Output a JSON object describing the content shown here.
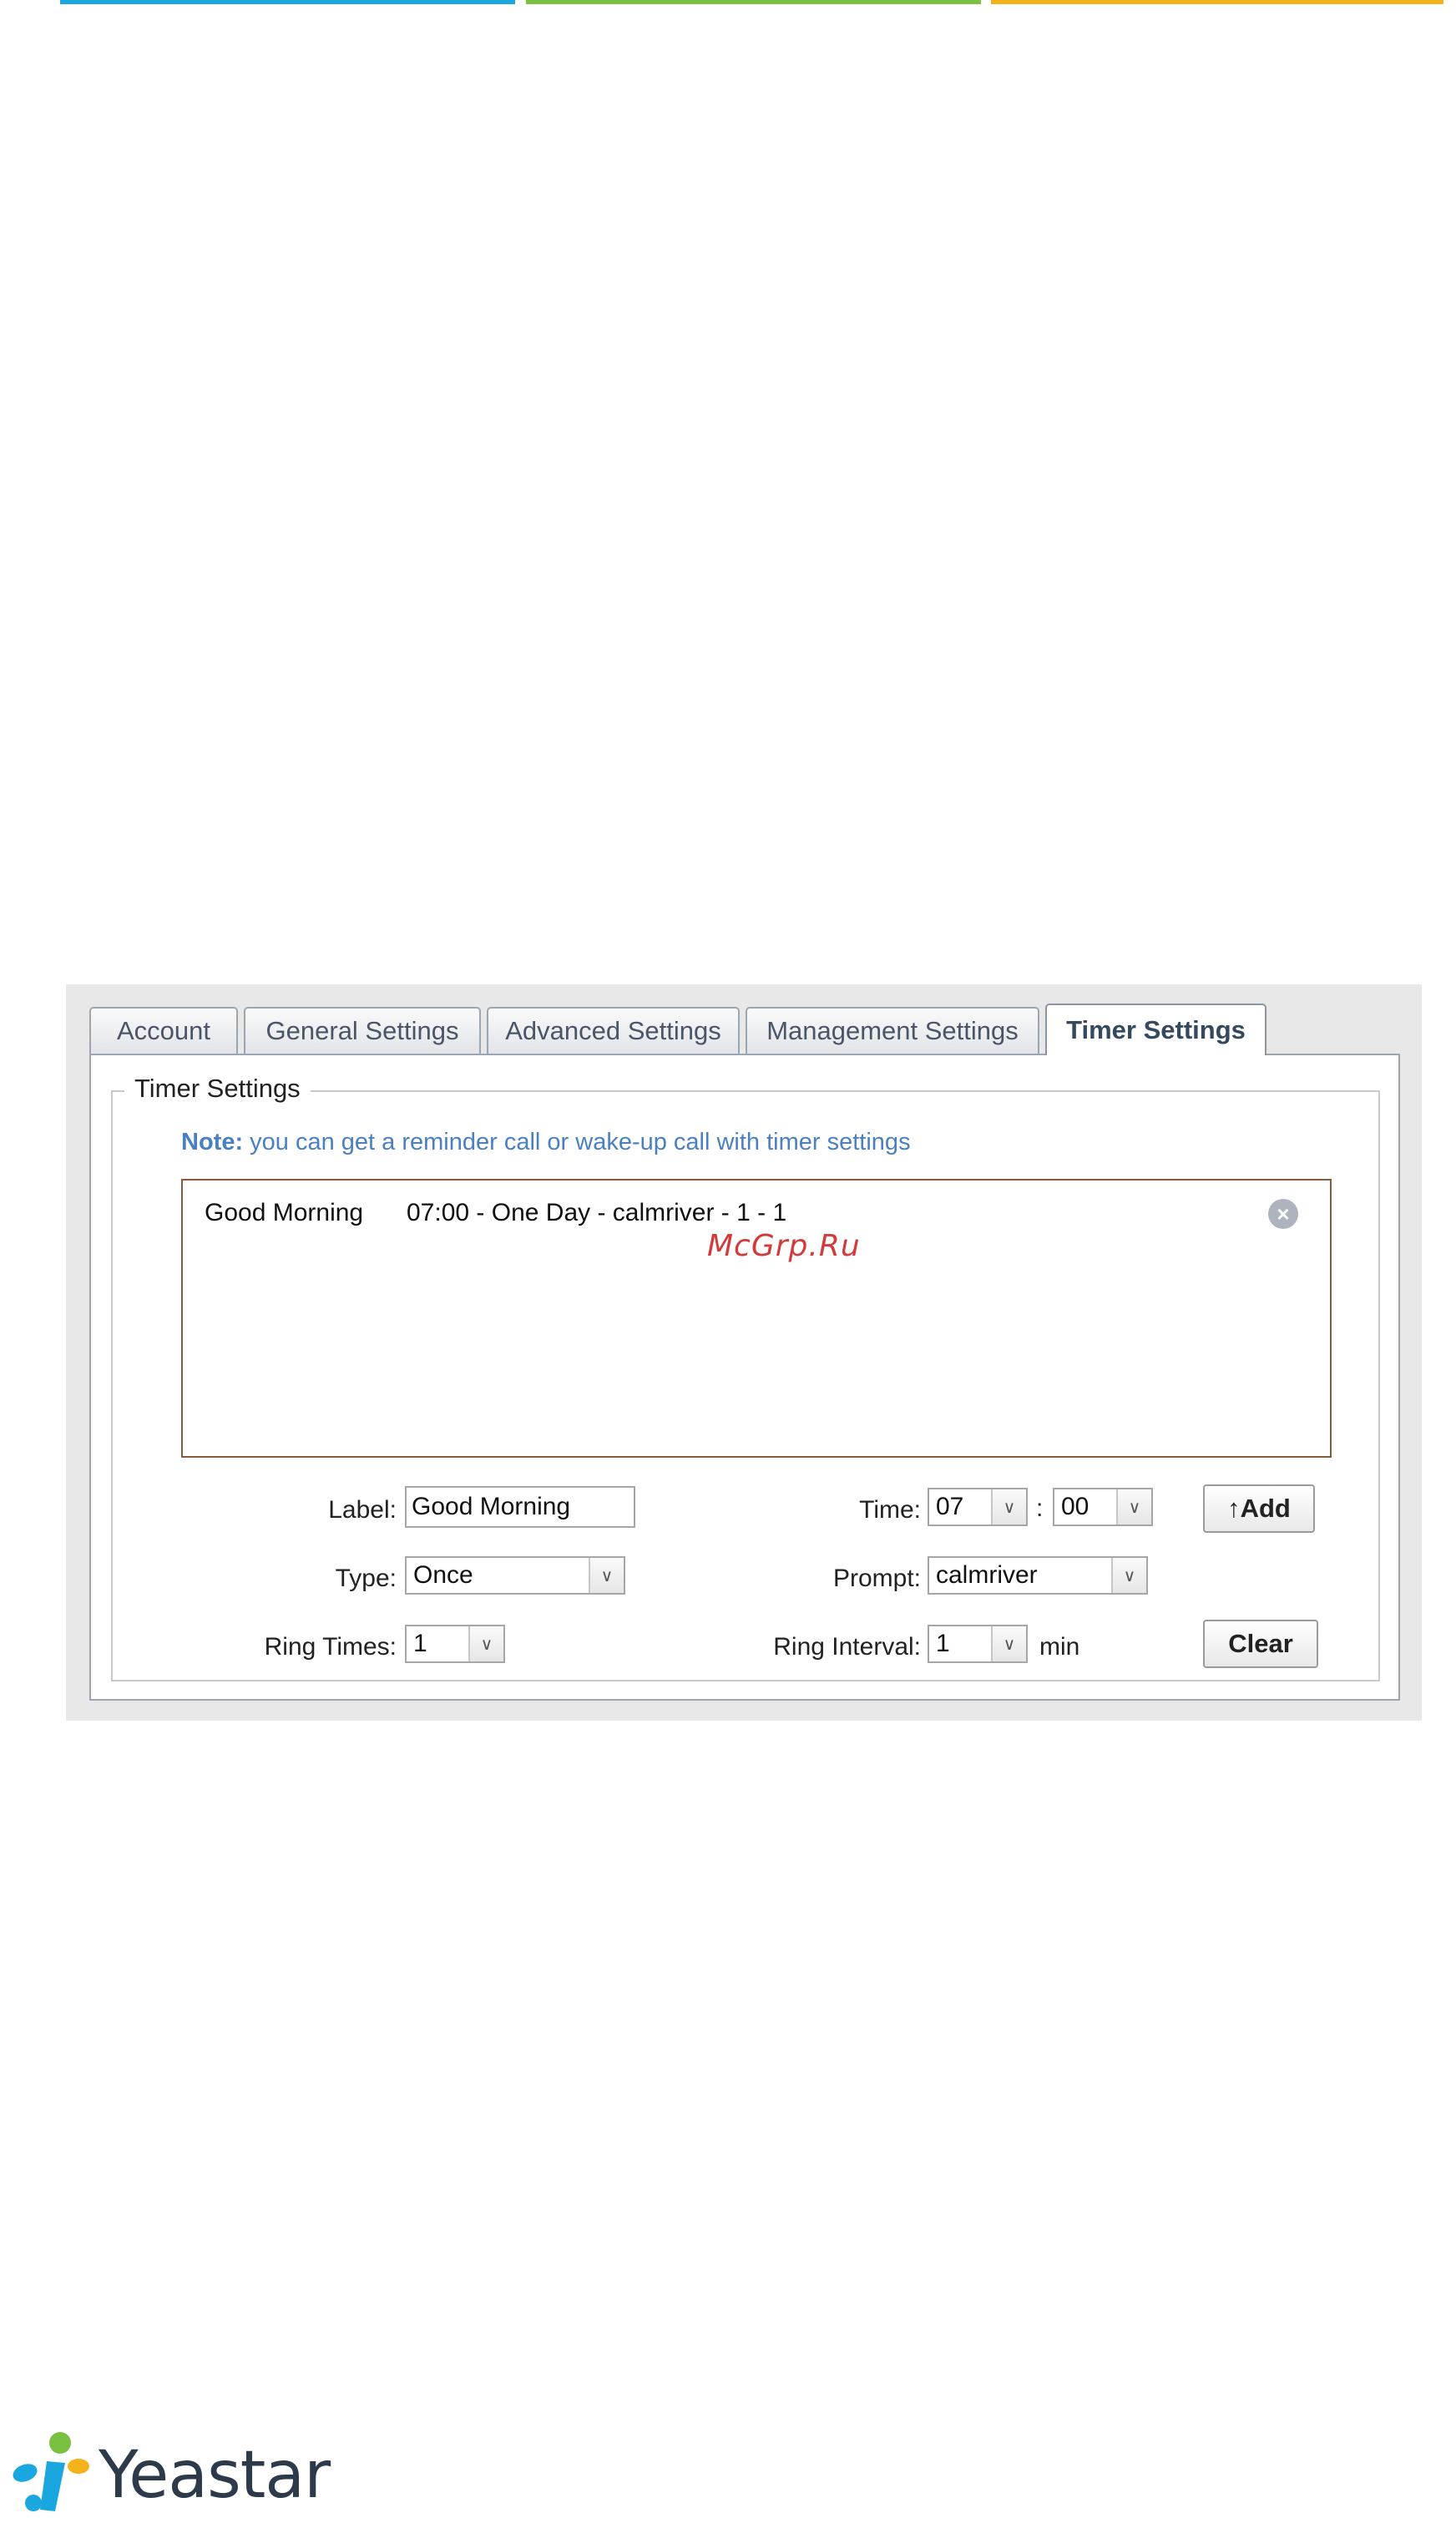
{
  "tabs": [
    {
      "label": "Account",
      "active": false
    },
    {
      "label": "General Settings",
      "active": false
    },
    {
      "label": "Advanced Settings",
      "active": false
    },
    {
      "label": "Management Settings",
      "active": false
    },
    {
      "label": "Timer Settings",
      "active": true
    }
  ],
  "section": {
    "legend": "Timer Settings",
    "note_prefix": "Note:",
    "note_text": " you can get a reminder call or wake-up call with timer settings"
  },
  "timer_list": [
    {
      "label": "Good Morning",
      "details": "07:00 - One Day - calmriver - 1 - 1"
    }
  ],
  "watermark": "McGrp.Ru",
  "form": {
    "label_field": {
      "label": "Label:",
      "value": "Good Morning"
    },
    "time_field": {
      "label": "Time:",
      "hour": "07",
      "separator": ":",
      "minute": "00"
    },
    "add_button": "↑Add",
    "type_field": {
      "label": "Type:",
      "value": "Once"
    },
    "prompt_field": {
      "label": "Prompt:",
      "value": "calmriver"
    },
    "ring_times_field": {
      "label": "Ring Times:",
      "value": "1"
    },
    "ring_interval_field": {
      "label": "Ring Interval:",
      "value": "1",
      "unit": "min"
    },
    "clear_button": "Clear"
  },
  "logo": {
    "text": "Yeastar"
  },
  "colors": {
    "bar_blue": "#1aa7e0",
    "bar_green": "#7ac142",
    "bar_orange": "#f6b21b",
    "note_blue": "#4a7fc1",
    "listbox_border": "#8b5a3c"
  }
}
